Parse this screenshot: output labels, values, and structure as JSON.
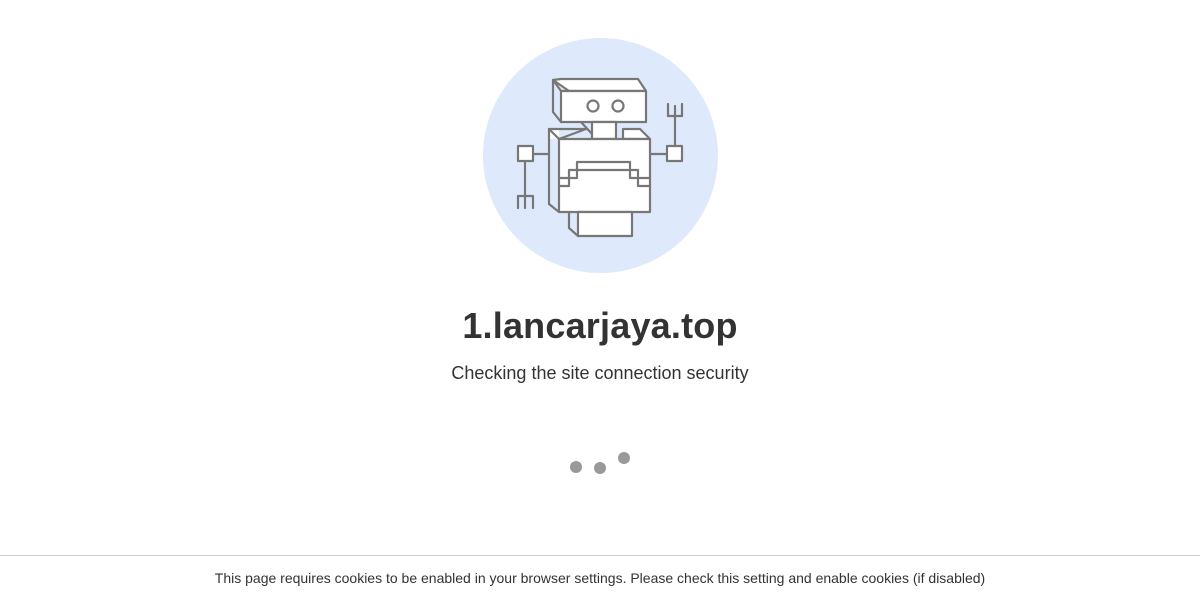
{
  "illustration": {
    "icon": "robot-icon",
    "circle_color": "#deeafb",
    "stroke_color": "#777777"
  },
  "header": {
    "domain": "1.lancarjaya.top"
  },
  "status": {
    "message": "Checking the site connection security"
  },
  "loader": {
    "icon": "loading-dots-icon",
    "dot_color": "#999999"
  },
  "footer": {
    "notice": "This page requires cookies to be enabled in your browser settings. Please check this setting and enable cookies (if disabled)"
  }
}
